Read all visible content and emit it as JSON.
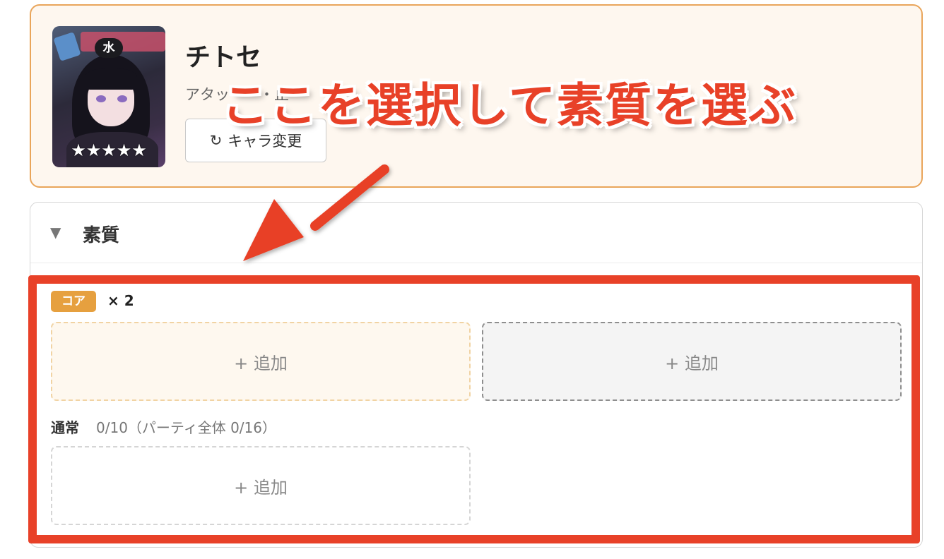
{
  "character": {
    "name": "チトセ",
    "role": "アタッ・・・止",
    "element": "水",
    "stars": "★★★★★",
    "change_button_label": "キャラ変更",
    "change_button_icon": "refresh-icon"
  },
  "traits": {
    "title": "素質",
    "toggle_icon": "triangle-down-icon",
    "core": {
      "tag": "コア",
      "count": "× 2",
      "slots": [
        {
          "label": "+ 追加"
        },
        {
          "label": "+ 追加"
        }
      ]
    },
    "normal": {
      "label": "通常",
      "count": "0/10（パーティ全体 0/16）",
      "slots": [
        {
          "label": "+ 追加"
        }
      ]
    }
  },
  "annotation": {
    "text": "ここを選択して素質を選ぶ",
    "color": "#e84128"
  },
  "colors": {
    "card_border": "#e9a55a",
    "card_bg": "#fef7ef",
    "core_tag": "#e6a03f",
    "annotation": "#e84128"
  }
}
